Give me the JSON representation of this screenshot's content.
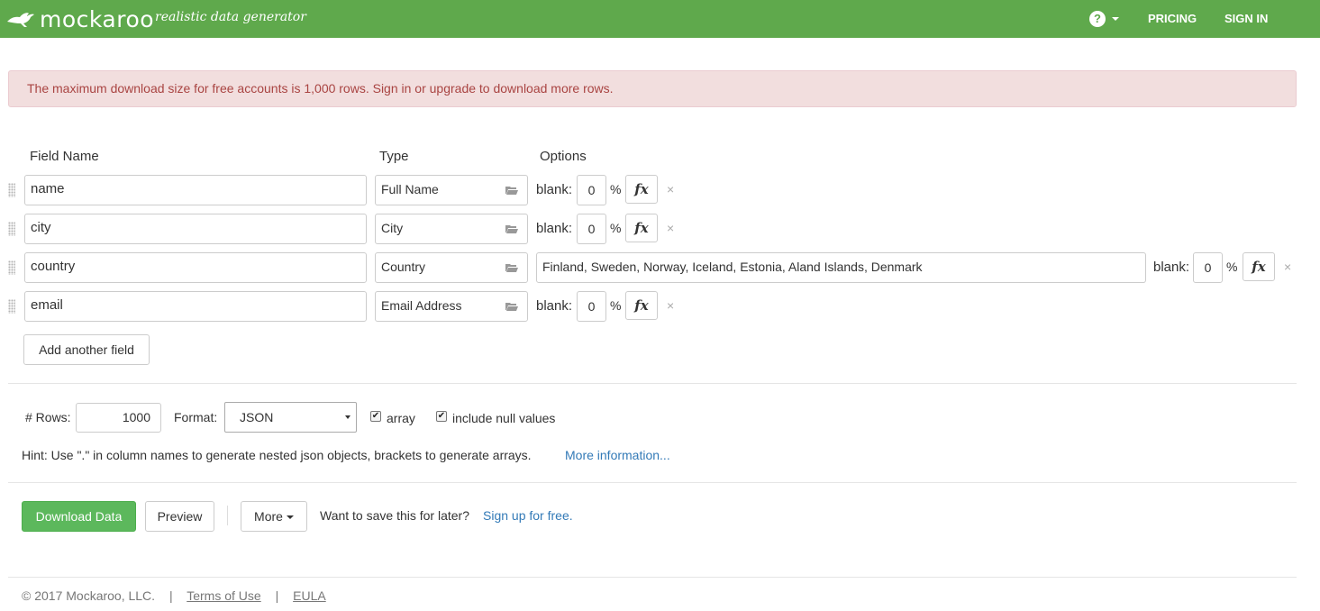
{
  "header": {
    "brand": "mockaroo",
    "tagline": "realistic data generator",
    "help_icon": "question-circle-icon",
    "nav": {
      "pricing": "PRICING",
      "sign_in": "SIGN IN"
    }
  },
  "alert": {
    "message": "The maximum download size for free accounts is 1,000 rows. Sign in or upgrade to download more rows."
  },
  "columns": {
    "field_name": "Field Name",
    "type": "Type",
    "options": "Options"
  },
  "fields": [
    {
      "name": "name",
      "type": "Full Name",
      "blank_label": "blank:",
      "blank": "0",
      "pct": "%",
      "fx": "fx",
      "remove": "×"
    },
    {
      "name": "city",
      "type": "City",
      "blank_label": "blank:",
      "blank": "0",
      "pct": "%",
      "fx": "fx",
      "remove": "×"
    },
    {
      "name": "country",
      "type": "Country",
      "options": "Finland, Sweden, Norway, Iceland, Estonia, Aland Islands, Denmark",
      "blank_label": "blank:",
      "blank": "0",
      "pct": "%",
      "fx": "fx",
      "remove": "×"
    },
    {
      "name": "email",
      "type": "Email Address",
      "blank_label": "blank:",
      "blank": "0",
      "pct": "%",
      "fx": "fx",
      "remove": "×"
    }
  ],
  "add_field_label": "Add another field",
  "settings": {
    "rows_label": "# Rows:",
    "rows_value": "1000",
    "format_label": "Format:",
    "format_value": "JSON",
    "array_label": "array",
    "array_checked": true,
    "null_label": "include null values",
    "null_checked": true,
    "hint": "Hint: Use \".\" in column names to generate nested json objects, brackets to generate arrays.",
    "hint_link": "More information..."
  },
  "actions": {
    "download": "Download Data",
    "preview": "Preview",
    "more": "More",
    "save_prompt": "Want to save this for later?",
    "signup": "Sign up for free."
  },
  "footer": {
    "copyright": "© 2017 Mockaroo, LLC.",
    "separator": "|",
    "terms": "Terms of Use",
    "eula": "EULA"
  },
  "colors": {
    "navbar": "#5fa94c",
    "alert_bg": "#f2dede",
    "alert_text": "#a94442",
    "success": "#5cb85c",
    "link": "#337ab7"
  }
}
